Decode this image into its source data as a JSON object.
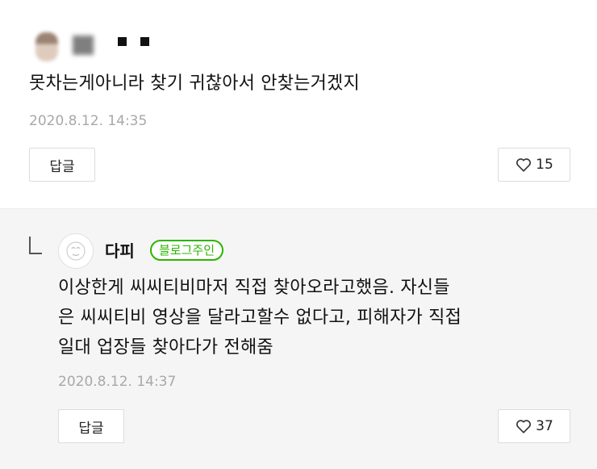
{
  "comment": {
    "text": "못차는게아니라 찾기 귀찮아서 안찾는거겠지",
    "date": "2020.8.12. 14:35",
    "reply_label": "답글",
    "like_count": "15"
  },
  "reply": {
    "author": "다피",
    "badge": "블로그주인",
    "text_line1": "이상한게 씨씨티비마저 직접 찾아오라고했음. 자신들",
    "text_line2": "은 씨씨티비 영상을 달라고할수 없다고, 피해자가 직접",
    "text_line3": "일대 업장들 찾아다가 전해줌",
    "date": "2020.8.12. 14:37",
    "reply_label": "답글",
    "like_count": "37"
  },
  "colors": {
    "badge_green": "#2db400",
    "reply_bg": "#f5f5f5",
    "date_gray": "#a8a8a8"
  }
}
